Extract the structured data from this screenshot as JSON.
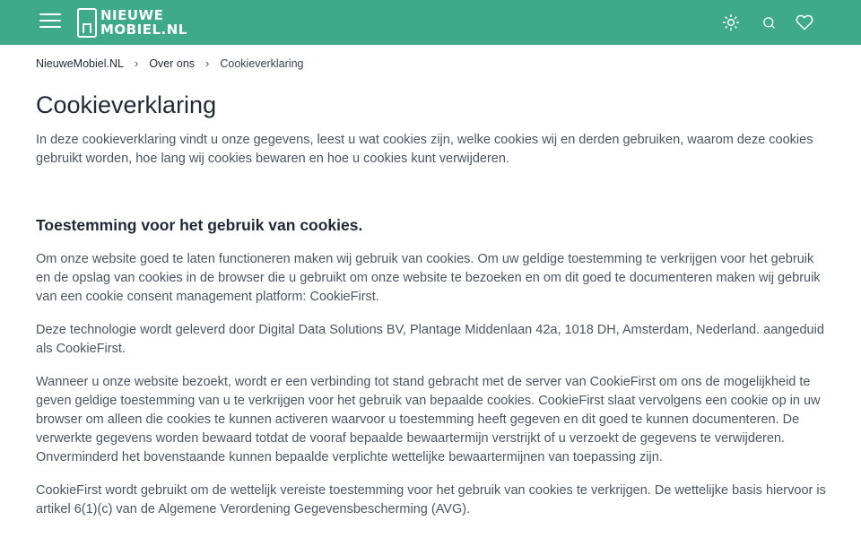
{
  "header": {
    "logo_line1": "NIEUWE",
    "logo_line2": "MOBIEL.NL",
    "menu_icon": "hamburger-icon",
    "icons": [
      "sun-icon",
      "search-icon",
      "heart-icon"
    ]
  },
  "breadcrumb": {
    "items": [
      "NieuweMobiel.NL",
      "Over ons",
      "Cookieverklaring"
    ],
    "separator": "›"
  },
  "page": {
    "title": "Cookieverklaring",
    "intro": "In deze cookieverklaring vindt u onze gegevens, leest u wat cookies zijn, welke cookies wij en derden gebruiken, waarom deze cookies gebruikt worden, hoe lang wij cookies bewaren en hoe u cookies kunt verwijderen.",
    "section_title": "Toestemming voor het gebruik van cookies.",
    "paragraphs": [
      "Om onze website goed te laten functioneren maken wij gebruik van cookies. Om uw geldige toestemming te verkrijgen voor het gebruik en de opslag van cookies in de browser die u gebruikt om onze website te bezoeken en om dit goed te documenteren maken wij gebruik van een cookie consent management platform: CookieFirst.",
      "Deze technologie wordt geleverd door Digital Data Solutions BV, Plantage Middenlaan 42a, 1018 DH, Amsterdam, Nederland. aangeduid als CookieFirst.",
      "Wanneer u onze website bezoekt, wordt er een verbinding tot stand gebracht met de server van CookieFirst om ons de mogelijkheid te geven geldige toestemming van u te verkrijgen voor het gebruik van bepaalde cookies. CookieFirst slaat vervolgens een cookie op in uw browser om alleen die cookies te kunnen activeren waarvoor u toestemming heeft gegeven en dit goed te kunnen documenteren. De verwerkte gegevens worden bewaard totdat de vooraf bepaalde bewaartermijn verstrijkt of u verzoekt de gegevens te verwijderen. Onverminderd het bovenstaande kunnen bepaalde verplichte wettelijke bewaartermijnen van toepassing zijn.",
      "CookieFirst wordt gebruikt om de wettelijk vereiste toestemming voor het gebruik van cookies te verkrijgen. De wettelijke basis hiervoor is artikel 6(1)(c) van de Algemene Verordening Gegevensbescherming (AVG)."
    ]
  },
  "colors": {
    "header_bg": "#3eaa8a",
    "text": "#4b5563",
    "heading": "#1f2937"
  }
}
